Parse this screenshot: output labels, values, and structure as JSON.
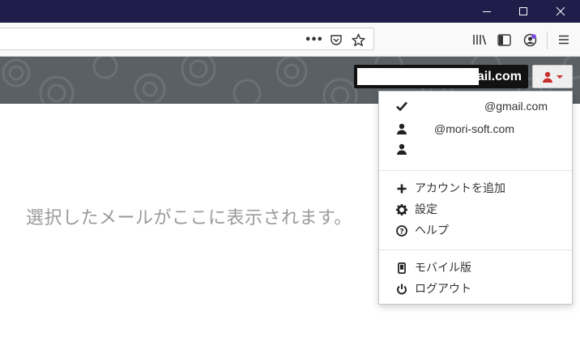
{
  "window_controls": {
    "minimize_icon": "minimize-icon",
    "maximize_icon": "maximize-icon",
    "close_icon": "close-icon"
  },
  "browser_toolbar": {
    "more_actions": "•••",
    "icons": [
      "pocket-icon",
      "star-icon",
      "library-icon",
      "reader-sidebar-icon",
      "account-icon",
      "hamburger-menu-icon"
    ]
  },
  "header": {
    "account_email_suffix": "@gmail.com"
  },
  "main": {
    "empty_message": "選択したメールがここに表示されます。"
  },
  "account_menu": {
    "accounts": [
      {
        "icon": "checkmark-icon",
        "label": "@gmail.com",
        "active": true
      },
      {
        "icon": "user-icon",
        "label": "@mori-soft.com",
        "active": false
      },
      {
        "icon": "user-icon",
        "label": "",
        "active": false
      }
    ],
    "actions": [
      {
        "icon": "plus-icon",
        "label": "アカウントを追加"
      },
      {
        "icon": "gear-icon",
        "label": "設定"
      },
      {
        "icon": "help-icon",
        "label": "ヘルプ"
      }
    ],
    "extras": [
      {
        "icon": "mobile-icon",
        "label": "モバイル版"
      },
      {
        "icon": "power-icon",
        "label": "ログアウト"
      }
    ]
  },
  "colors": {
    "titlebar": "#1f1d49",
    "header_bg": "#5a6064",
    "accent_red": "#c9302c",
    "placeholder_text": "#9a9a9a"
  }
}
